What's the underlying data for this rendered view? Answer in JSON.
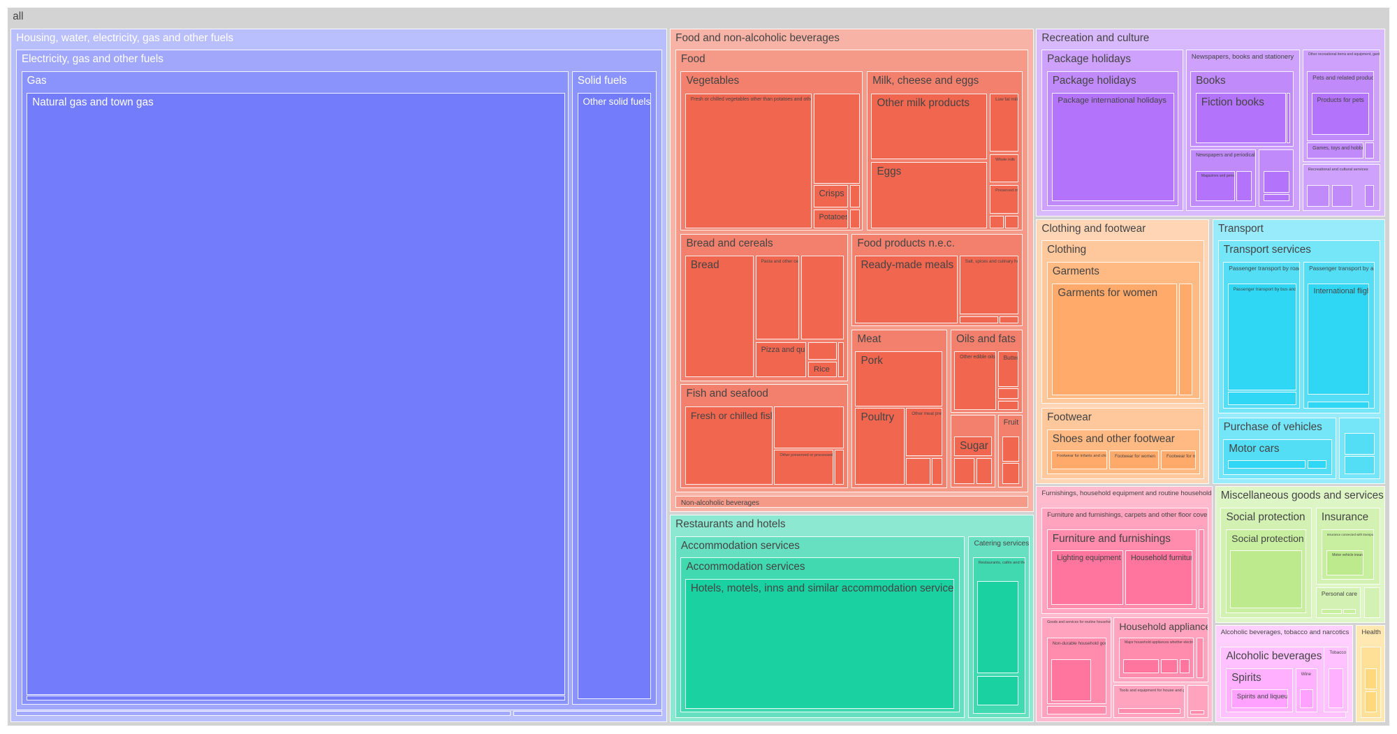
{
  "chart_data": {
    "type": "treemap",
    "root_label": "all",
    "colors": {
      "root": "#d3d3d3",
      "housing": "#636efa",
      "food": "#ef553b",
      "restaurants": "#00cc96",
      "recreation": "#ab63fa",
      "clothing": "#ffa15a",
      "transport": "#19d3f3",
      "furnishings": "#ff6692",
      "misc": "#b6e880",
      "alcohol": "#ff97ff",
      "health": "#fecb52"
    },
    "labels": {
      "root": "all",
      "housing": "Housing, water, electricity, gas and other fuels",
      "elec": "Electricity, gas and other fuels",
      "gas": "Gas",
      "natgas": "Natural gas and town gas",
      "solid": "Solid fuels",
      "othersolid": "Other solid fuels",
      "foodbev": "Food and non-alcoholic beverages",
      "food": "Food",
      "veg": "Vegetables",
      "vegfresh": "Fresh or chilled vegetables other than potatoes and other tubers",
      "crisps": "Crisps",
      "potatoes": "Potatoes",
      "milk": "Milk, cheese and eggs",
      "othermilk": "Other milk products",
      "eggs": "Eggs",
      "lowfatmilk": "Low fat milk",
      "wholemilk": "Whole milk",
      "preservedmilk": "Preserved milk",
      "bread_cereals": "Bread and cereals",
      "bread": "Bread",
      "pasta": "Pasta and other cereals",
      "pizza": "Pizza and quiche",
      "rice": "Rice",
      "foodnec": "Food products n.e.c.",
      "readymeals": "Ready-made meals",
      "saltspices": "Salt, spices and culinary herbs",
      "meat": "Meat",
      "pork": "Pork",
      "poultry": "Poultry",
      "othermeat": "Other meat preparations",
      "oils": "Oils and fats",
      "otheroils": "Other edible oils",
      "butter": "Butter",
      "sugar": "Sugar",
      "fruit": "Fruit",
      "fish": "Fish and seafood",
      "freshfish": "Fresh or chilled fish",
      "driedfish": "Other preserved or processed fish",
      "nonalc": "Non-alcoholic beverages",
      "restaurants": "Restaurants and hotels",
      "accom1": "Accommodation services",
      "accom2": "Accommodation services",
      "hotels": "Hotels, motels, inns and similar accommodation services",
      "catering": "Catering services",
      "restcafes": "Restaurants, cafés and the like",
      "recreation": "Recreation and culture",
      "pkg1": "Package holidays",
      "pkg2": "Package holidays",
      "pkgintl": "Package international holidays",
      "newspapers": "Newspapers, books and stationery",
      "books": "Books",
      "fiction": "Fiction books",
      "newsper": "Newspapers and periodicals",
      "magazines": "Magazines and periodicals",
      "otherrec": "Other recreational items and equipment, gardens and pets",
      "pets": "Pets and related products",
      "petproducts": "Products for pets",
      "games": "Games, toys and hobbies",
      "reccultural": "Recreational and cultural services",
      "clothing_fw": "Clothing and footwear",
      "clothing": "Clothing",
      "garments": "Garments",
      "garmentswomen": "Garments for women",
      "footwear": "Footwear",
      "shoes": "Shoes and other footwear",
      "fwinfants": "Footwear for infants and children",
      "fwwomen": "Footwear for women",
      "fwmen": "Footwear for men",
      "transport": "Transport",
      "transportsvc": "Transport services",
      "roadpass": "Passenger transport by road",
      "buscoach": "Passenger transport by bus and coach",
      "airpass": "Passenger transport by air",
      "intlflights": "International flights",
      "purchasevehicles": "Purchase of vehicles",
      "motorcars": "Motor cars",
      "furnishings": "Furnishings, household equipment and routine household maintenance",
      "furniture_carpets": "Furniture and furnishings, carpets and other floor coverings",
      "furniture": "Furniture and furnishings",
      "lighting": "Lighting equipment",
      "hhfurniture": "Household furniture",
      "goods_services": "Goods and services for routine household maintenance",
      "nondurable": "Non-durable household goods",
      "appliances": "Household appliances",
      "majorappliances": "Major household appliances whether electric or not",
      "tools": "Tools and equipment for house and garden",
      "misc": "Miscellaneous goods and services",
      "socialprot1": "Social protection",
      "socialprot2": "Social protection",
      "insurance": "Insurance",
      "transportins": "Insurance connected with transport",
      "motorins": "Motor vehicle insurance",
      "personalcare": "Personal care",
      "alcohol_tobacco": "Alcoholic beverages, tobacco and narcotics",
      "alcbev": "Alcoholic beverages",
      "spirits": "Spirits",
      "spiritsliq": "Spirits and liqueurs",
      "wine": "Wine",
      "tobacco": "Tobacco",
      "health": "Health"
    }
  }
}
